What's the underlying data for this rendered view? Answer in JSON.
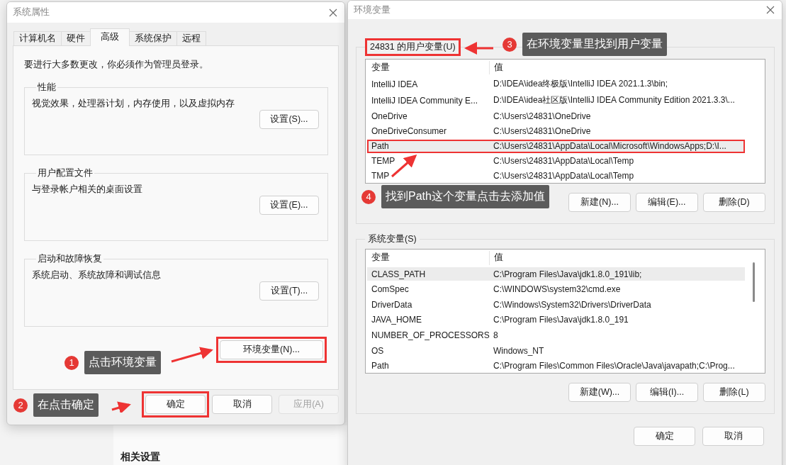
{
  "background": {
    "heading": "相关设置"
  },
  "system_properties": {
    "title": "系统属性",
    "tabs": [
      {
        "label": "计算机名",
        "selected": false
      },
      {
        "label": "硬件",
        "selected": false
      },
      {
        "label": "高级",
        "selected": true
      },
      {
        "label": "系统保护",
        "selected": false
      },
      {
        "label": "远程",
        "selected": false
      }
    ],
    "admin_note": "要进行大多数更改，你必须作为管理员登录。",
    "groups": [
      {
        "title": "性能",
        "description": "视觉效果，处理器计划，内存使用，以及虚拟内存",
        "button": "设置(S)..."
      },
      {
        "title": "用户配置文件",
        "description": "与登录帐户相关的桌面设置",
        "button": "设置(E)..."
      },
      {
        "title": "启动和故障恢复",
        "description": "系统启动、系统故障和调试信息",
        "button": "设置(T)..."
      }
    ],
    "env_button": {
      "label": "环境变量(N)...",
      "highlighted": true
    },
    "buttons": [
      {
        "label": "确定",
        "disabled": false,
        "highlighted": true
      },
      {
        "label": "取消",
        "disabled": false,
        "highlighted": false
      },
      {
        "label": "应用(A)",
        "disabled": true,
        "highlighted": false
      }
    ]
  },
  "environment_variables": {
    "title": "环境变量",
    "user_variables": {
      "title": "24831 的用户变量(U)",
      "highlighted": true,
      "columns": [
        "变量",
        "值"
      ],
      "rows": [
        {
          "name": "IntelliJ IDEA",
          "value": "D:\\IDEA\\idea终极版\\IntelliJ IDEA 2021.1.3\\bin;",
          "selected": false,
          "highlighted": false
        },
        {
          "name": "IntelliJ IDEA Community E...",
          "value": "D:\\IDEA\\idea社区版\\IntelliJ IDEA Community Edition 2021.3.3\\...",
          "selected": false,
          "highlighted": false
        },
        {
          "name": "OneDrive",
          "value": "C:\\Users\\24831\\OneDrive",
          "selected": false,
          "highlighted": false
        },
        {
          "name": "OneDriveConsumer",
          "value": "C:\\Users\\24831\\OneDrive",
          "selected": false,
          "highlighted": false
        },
        {
          "name": "Path",
          "value": "C:\\Users\\24831\\AppData\\Local\\Microsoft\\WindowsApps;D:\\I...",
          "selected": true,
          "highlighted": true
        },
        {
          "name": "TEMP",
          "value": "C:\\Users\\24831\\AppData\\Local\\Temp",
          "selected": false,
          "highlighted": false
        },
        {
          "name": "TMP",
          "value": "C:\\Users\\24831\\AppData\\Local\\Temp",
          "selected": false,
          "highlighted": false
        }
      ],
      "buttons": [
        "新建(N)...",
        "编辑(E)...",
        "删除(D)"
      ]
    },
    "system_variables": {
      "title": "系统变量(S)",
      "highlighted": false,
      "columns": [
        "变量",
        "值"
      ],
      "rows": [
        {
          "name": "CLASS_PATH",
          "value": "C:\\Program Files\\Java\\jdk1.8.0_191\\lib;",
          "selected": true,
          "highlighted": false
        },
        {
          "name": "ComSpec",
          "value": "C:\\WINDOWS\\system32\\cmd.exe",
          "selected": false,
          "highlighted": false
        },
        {
          "name": "DriverData",
          "value": "C:\\Windows\\System32\\Drivers\\DriverData",
          "selected": false,
          "highlighted": false
        },
        {
          "name": "JAVA_HOME",
          "value": "C:\\Program Files\\Java\\jdk1.8.0_191",
          "selected": false,
          "highlighted": false
        },
        {
          "name": "NUMBER_OF_PROCESSORS",
          "value": "8",
          "selected": false,
          "highlighted": false
        },
        {
          "name": "OS",
          "value": "Windows_NT",
          "selected": false,
          "highlighted": false
        },
        {
          "name": "Path",
          "value": "C:\\Program Files\\Common Files\\Oracle\\Java\\javapath;C:\\Prog...",
          "selected": false,
          "highlighted": false
        }
      ],
      "buttons": [
        "新建(W)...",
        "编辑(I)...",
        "删除(L)"
      ]
    },
    "buttons": [
      "确定",
      "取消"
    ]
  },
  "annotations": [
    {
      "number": "1",
      "text": "点击环境变量"
    },
    {
      "number": "2",
      "text": "在点击确定"
    },
    {
      "number": "3",
      "text": "在环境变量里找到用户变量"
    },
    {
      "number": "4",
      "text": "找到Path这个变量点击去添加值"
    }
  ]
}
